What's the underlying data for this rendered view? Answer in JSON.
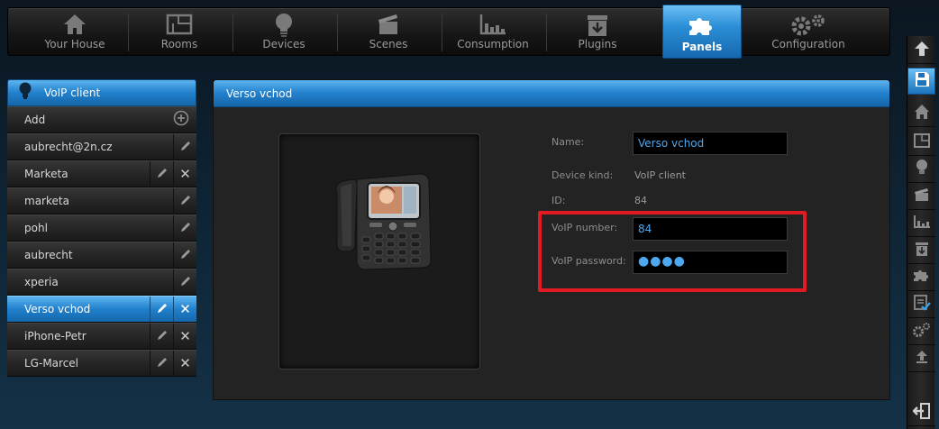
{
  "nav": {
    "items": [
      {
        "label": "Your House"
      },
      {
        "label": "Rooms"
      },
      {
        "label": "Devices"
      },
      {
        "label": "Scenes"
      },
      {
        "label": "Consumption"
      },
      {
        "label": "Plugins"
      },
      {
        "label": "Panels",
        "active": true
      },
      {
        "label": "Configuration"
      }
    ]
  },
  "sidebar": {
    "title": "VoIP client",
    "add_label": "Add",
    "items": [
      {
        "label": "aubrecht@2n.cz",
        "deletable": false,
        "selected": false
      },
      {
        "label": "Marketa",
        "deletable": true,
        "selected": false
      },
      {
        "label": "marketa",
        "deletable": false,
        "selected": false
      },
      {
        "label": "pohl",
        "deletable": false,
        "selected": false
      },
      {
        "label": "aubrecht",
        "deletable": false,
        "selected": false
      },
      {
        "label": "xperia",
        "deletable": false,
        "selected": false
      },
      {
        "label": "Verso vchod",
        "deletable": true,
        "selected": true
      },
      {
        "label": "iPhone-Petr",
        "deletable": true,
        "selected": false
      },
      {
        "label": "LG-Marcel",
        "deletable": true,
        "selected": false
      }
    ]
  },
  "main": {
    "title": "Verso vchod",
    "form": {
      "name_label": "Name:",
      "name_value": "Verso vchod",
      "kind_label": "Device kind:",
      "kind_value": "VoIP client",
      "id_label": "ID:",
      "id_value": "84",
      "number_label": "VoIP number:",
      "number_value": "84",
      "password_label": "VoIP password:",
      "password_value": "●●●●"
    }
  },
  "colors": {
    "accent": "#2180cc",
    "input_text": "#4ea8f0",
    "highlight": "#e01b24"
  }
}
